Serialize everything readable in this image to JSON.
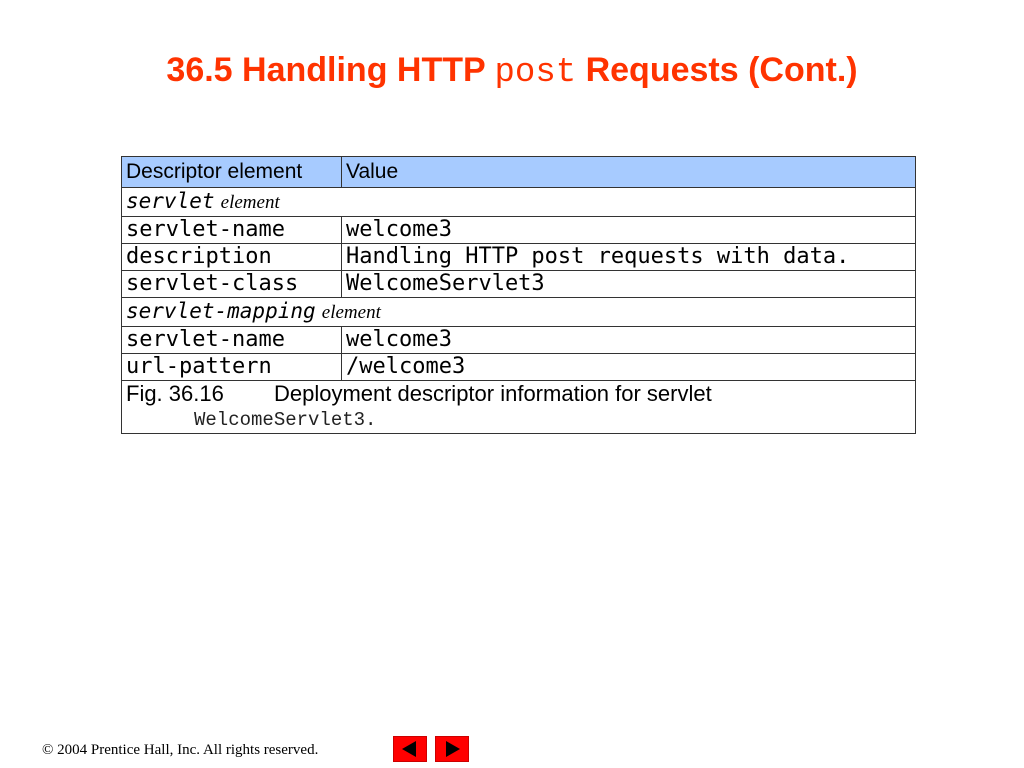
{
  "slide": {
    "title_prefix": "36.5 Handling HTTP ",
    "title_code": "post",
    "title_suffix": " Requests (Cont.)"
  },
  "table": {
    "headers": [
      "Descriptor element",
      "Value"
    ],
    "sections": [
      {
        "name": "servlet",
        "suffix": "element",
        "rows": [
          {
            "key": "servlet-name",
            "value": "welcome3"
          },
          {
            "key": "description",
            "value": "Handling HTTP post requests with data."
          },
          {
            "key": "servlet-class",
            "value": "WelcomeServlet3"
          }
        ]
      },
      {
        "name": "servlet-mapping",
        "suffix": "element",
        "rows": [
          {
            "key": "servlet-name",
            "value": "welcome3"
          },
          {
            "key": "url-pattern",
            "value": "/welcome3"
          }
        ]
      }
    ],
    "caption": {
      "figure": "Fig. 36.16",
      "text": "Deployment descriptor information for servlet",
      "code": "WelcomeServlet3",
      "end": "."
    }
  },
  "footer": {
    "text": "© 2004 Prentice Hall, Inc.  All rights reserved."
  },
  "nav": {
    "prev_icon": "left-triangle",
    "next_icon": "right-triangle",
    "button_color": "#ff0000"
  },
  "colors": {
    "title": "#ff3300",
    "header_bg": "#a7cbff"
  }
}
